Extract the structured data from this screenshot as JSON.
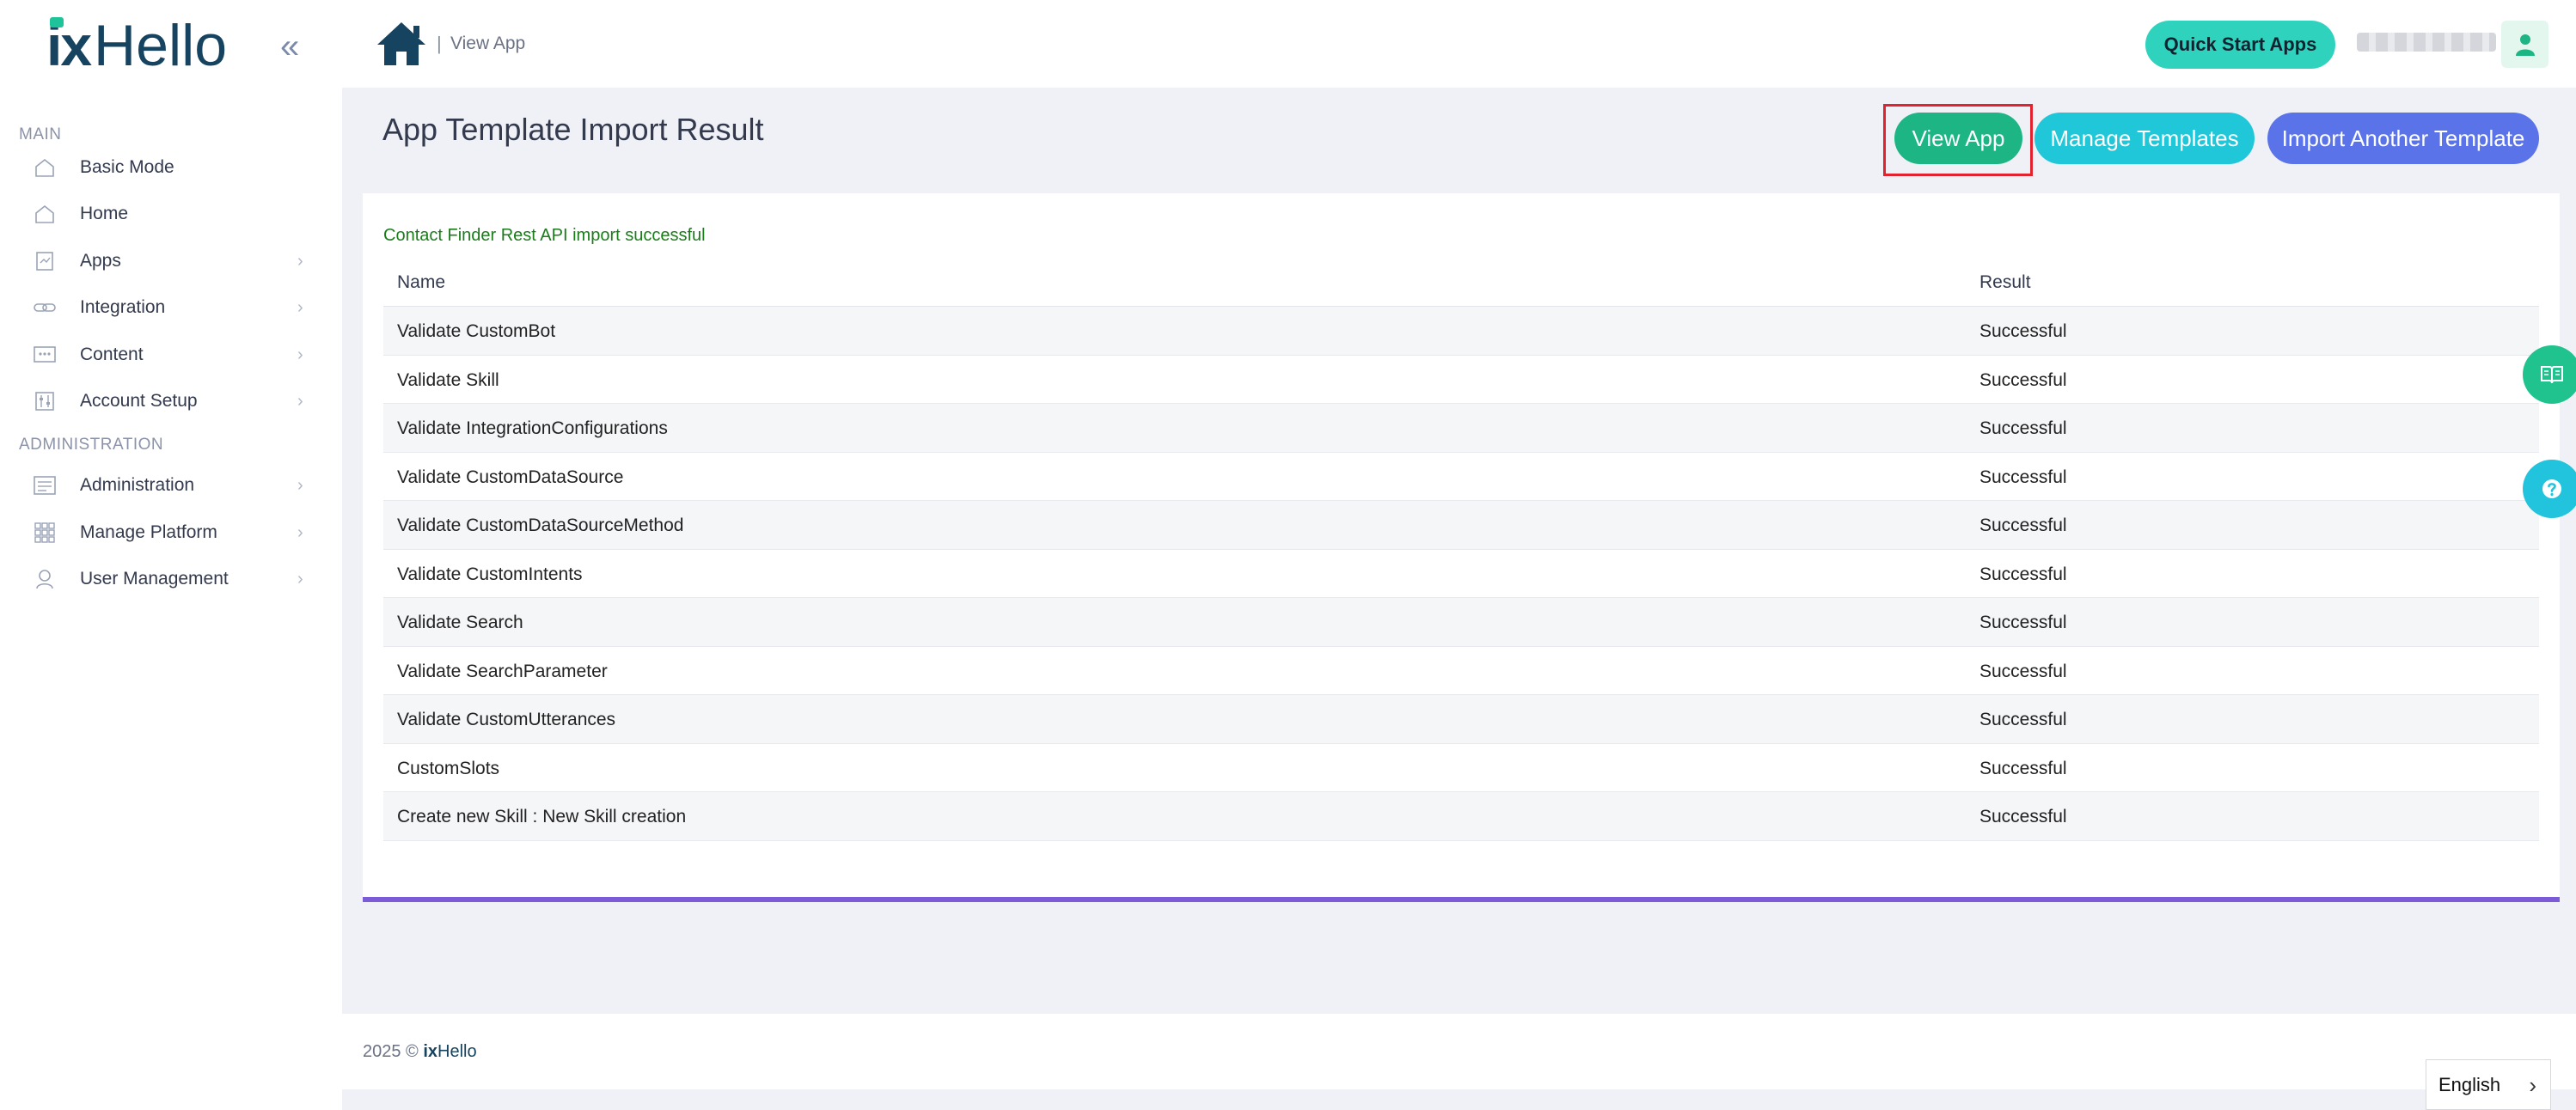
{
  "brand": {
    "logo_ix": "ix",
    "logo_hello": "Hello"
  },
  "sidebar": {
    "section_main": "MAIN",
    "section_admin": "ADMINISTRATION",
    "items": [
      {
        "label": "Basic Mode",
        "icon": "home-outline-icon",
        "has_submenu": false
      },
      {
        "label": "Home",
        "icon": "home-outline-icon",
        "has_submenu": false
      },
      {
        "label": "Apps",
        "icon": "apps-icon",
        "has_submenu": true
      },
      {
        "label": "Integration",
        "icon": "link-icon",
        "has_submenu": true
      },
      {
        "label": "Content",
        "icon": "content-icon",
        "has_submenu": true
      },
      {
        "label": "Account Setup",
        "icon": "settings-sliders-icon",
        "has_submenu": true
      },
      {
        "label": "Administration",
        "icon": "admin-icon",
        "has_submenu": true
      },
      {
        "label": "Manage Platform",
        "icon": "grid-icon",
        "has_submenu": true
      },
      {
        "label": "User Management",
        "icon": "user-icon",
        "has_submenu": true
      }
    ]
  },
  "header": {
    "breadcrumb_sep": "|",
    "breadcrumb": "View App",
    "quick_start": "Quick Start Apps"
  },
  "main": {
    "title": "App Template Import Result",
    "buttons": {
      "view_app": "View App",
      "manage_templates": "Manage Templates",
      "import_another": "Import Another Template"
    },
    "success_message": "Contact Finder Rest API import successful",
    "table": {
      "columns": [
        "Name",
        "Result"
      ],
      "rows": [
        [
          "Validate CustomBot",
          "Successful"
        ],
        [
          "Validate Skill",
          "Successful"
        ],
        [
          "Validate IntegrationConfigurations",
          "Successful"
        ],
        [
          "Validate CustomDataSource",
          "Successful"
        ],
        [
          "Validate CustomDataSourceMethod",
          "Successful"
        ],
        [
          "Validate CustomIntents",
          "Successful"
        ],
        [
          "Validate Search",
          "Successful"
        ],
        [
          "Validate SearchParameter",
          "Successful"
        ],
        [
          "Validate CustomUtterances",
          "Successful"
        ],
        [
          "CustomSlots",
          "Successful"
        ],
        [
          "Create new Skill : New Skill creation",
          "Successful"
        ]
      ]
    }
  },
  "footer": {
    "copyright": "2025 ©",
    "logo_ix": "ix",
    "logo_hello": "Hello"
  },
  "language": {
    "selected": "English"
  },
  "colors": {
    "brand_dark": "#16435f",
    "brand_green": "#1ec39a",
    "view_app": "#1db584",
    "manage_templates": "#1fc7d8",
    "import_another": "#5b73e8",
    "quick_start": "#2fd3bd",
    "success_text": "#1a7d1a",
    "card_accent": "#7b5bd6",
    "highlight": "#e0232f"
  }
}
